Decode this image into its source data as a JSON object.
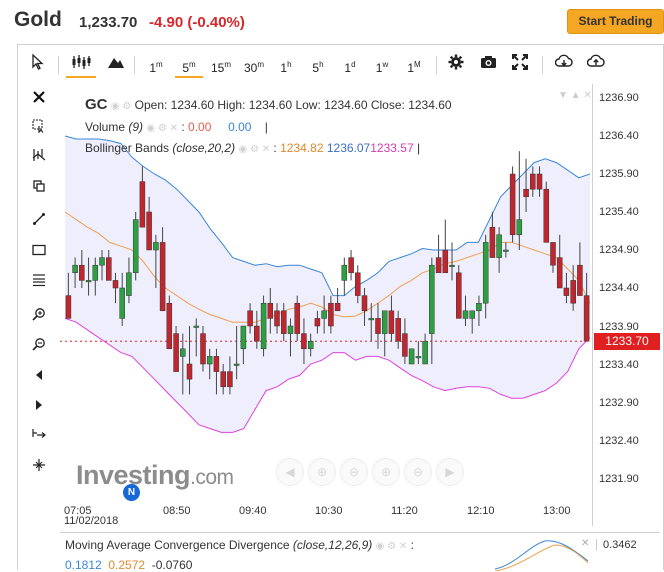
{
  "header": {
    "title": "Gold",
    "price": "1,233.70",
    "change": "-4.90 (-0.40%)",
    "start_trading": "Start Trading"
  },
  "toolbar": {
    "cursor_icon": "cursor-arrow-icon",
    "intervals": [
      {
        "base": "1",
        "sup": "m"
      },
      {
        "base": "5",
        "sup": "m"
      },
      {
        "base": "15",
        "sup": "m"
      },
      {
        "base": "30",
        "sup": "m"
      },
      {
        "base": "1",
        "sup": "h"
      },
      {
        "base": "5",
        "sup": "h"
      },
      {
        "base": "1",
        "sup": "d"
      },
      {
        "base": "1",
        "sup": "w"
      },
      {
        "base": "1",
        "sup": "M"
      }
    ],
    "active_interval": "5m"
  },
  "legend": {
    "symbol": "GC",
    "ohlc": "Open: 1234.60 High: 1234.60 Low: 1234.60 Close: 1234.60",
    "volume_label": "Volume",
    "volume_count": "(9)",
    "volume_val1": "0.00",
    "volume_val2": "0.00",
    "bb_label": "Bollinger Bands",
    "bb_params": "(close,20,2)",
    "bb_val1": "1234.82",
    "bb_val2": "1236.07",
    "bb_val3": "1233.57"
  },
  "price_axis": {
    "labels": [
      "1236.90",
      "1236.40",
      "1235.90",
      "1235.40",
      "1234.90",
      "1234.40",
      "1233.90",
      "1233.40",
      "1232.90",
      "1232.40",
      "1231.90"
    ],
    "current": "1233.70"
  },
  "time_axis": {
    "labels": [
      "07:05",
      "08:50",
      "09:40",
      "10:30",
      "11:20",
      "12:10",
      "13:00"
    ],
    "date": "11/02/2018"
  },
  "watermark": {
    "brand": "Investing",
    "suffix": ".com",
    "badge": "N"
  },
  "macd": {
    "label": "Moving Average Convergence Divergence",
    "params": "(close,12,26,9)",
    "value": "0.3462",
    "v1": "0.1812",
    "v2": "0.2572",
    "v3": "-0.0760"
  },
  "colors": {
    "up": "#2ea043",
    "down": "#c0262d",
    "band_upper": "#3a86d6",
    "band_lower": "#e040e0",
    "band_mid": "#f0a050",
    "band_fill": "#eeeefd",
    "accent": "#f5a623"
  },
  "chart_data": {
    "type": "candlestick",
    "ylim": [
      1231.7,
      1237.05
    ],
    "candles": [
      [
        1234.3,
        1234.6,
        1234.0,
        1234.0
      ],
      [
        1234.6,
        1234.8,
        1234.4,
        1234.7
      ],
      [
        1234.7,
        1234.9,
        1234.4,
        1234.5
      ],
      [
        1234.5,
        1234.8,
        1234.3,
        1234.5
      ],
      [
        1234.5,
        1234.8,
        1234.3,
        1234.7
      ],
      [
        1234.7,
        1234.9,
        1234.5,
        1234.8
      ],
      [
        1234.8,
        1234.9,
        1234.5,
        1234.5
      ],
      [
        1234.5,
        1234.6,
        1234.2,
        1234.4
      ],
      [
        1234.0,
        1234.6,
        1233.9,
        1234.4
      ],
      [
        1234.3,
        1234.8,
        1234.2,
        1234.6
      ],
      [
        1234.6,
        1235.4,
        1234.5,
        1235.3
      ],
      [
        1235.8,
        1236.0,
        1235.2,
        1235.2
      ],
      [
        1235.4,
        1235.6,
        1234.9,
        1234.9
      ],
      [
        1234.9,
        1235.1,
        1234.4,
        1235.0
      ],
      [
        1235.0,
        1235.2,
        1234.1,
        1234.1
      ],
      [
        1234.2,
        1234.3,
        1233.6,
        1233.6
      ],
      [
        1233.8,
        1233.9,
        1233.3,
        1233.3
      ],
      [
        1233.5,
        1233.8,
        1233.0,
        1233.6
      ],
      [
        1233.4,
        1233.9,
        1233.0,
        1233.2
      ],
      [
        1233.9,
        1234.0,
        1233.5,
        1233.9
      ],
      [
        1233.8,
        1233.9,
        1233.3,
        1233.4
      ],
      [
        1233.4,
        1233.6,
        1233.2,
        1233.5
      ],
      [
        1233.5,
        1233.6,
        1233.0,
        1233.3
      ],
      [
        1233.3,
        1233.4,
        1233.0,
        1233.1
      ],
      [
        1233.3,
        1233.5,
        1233.0,
        1233.1
      ],
      [
        1233.4,
        1233.9,
        1233.2,
        1233.4
      ],
      [
        1233.6,
        1233.9,
        1233.4,
        1233.9
      ],
      [
        1234.1,
        1234.2,
        1233.8,
        1233.9
      ],
      [
        1233.9,
        1234.1,
        1233.6,
        1233.7
      ],
      [
        1233.6,
        1234.3,
        1233.5,
        1234.2
      ],
      [
        1234.2,
        1234.4,
        1233.8,
        1234.0
      ],
      [
        1234.1,
        1234.2,
        1233.8,
        1233.9
      ],
      [
        1234.1,
        1234.2,
        1233.7,
        1233.8
      ],
      [
        1233.8,
        1234.0,
        1233.5,
        1233.9
      ],
      [
        1234.2,
        1234.3,
        1233.7,
        1233.8
      ],
      [
        1233.8,
        1234.0,
        1233.4,
        1233.6
      ],
      [
        1233.6,
        1233.8,
        1233.5,
        1233.7
      ],
      [
        1234.0,
        1234.1,
        1233.8,
        1233.9
      ],
      [
        1234.0,
        1234.3,
        1233.8,
        1234.1
      ],
      [
        1234.2,
        1234.3,
        1233.8,
        1233.9
      ],
      [
        1234.2,
        1234.4,
        1234.1,
        1234.1
      ],
      [
        1234.5,
        1234.8,
        1234.3,
        1234.7
      ],
      [
        1234.8,
        1234.9,
        1234.5,
        1234.6
      ],
      [
        1234.6,
        1234.7,
        1234.2,
        1234.3
      ],
      [
        1234.3,
        1234.4,
        1233.9,
        1234.1
      ],
      [
        1234.0,
        1234.2,
        1233.7,
        1234.0
      ],
      [
        1234.0,
        1234.2,
        1233.6,
        1233.8
      ],
      [
        1233.8,
        1234.0,
        1233.5,
        1234.1
      ],
      [
        1234.1,
        1234.3,
        1233.7,
        1233.8
      ],
      [
        1234.0,
        1234.1,
        1233.6,
        1233.7
      ],
      [
        1233.8,
        1234.0,
        1233.4,
        1233.5
      ],
      [
        1233.4,
        1233.6,
        1233.4,
        1233.6
      ],
      [
        1233.5,
        1233.7,
        1233.4,
        1233.5
      ],
      [
        1233.4,
        1233.8,
        1233.4,
        1233.7
      ],
      [
        1233.8,
        1234.8,
        1233.4,
        1234.7
      ],
      [
        1234.8,
        1235.1,
        1234.6,
        1234.6
      ],
      [
        1234.9,
        1235.3,
        1234.7,
        1234.6
      ],
      [
        1234.7,
        1235.0,
        1234.5,
        1234.7
      ],
      [
        1234.6,
        1234.7,
        1234.0,
        1234.0
      ],
      [
        1234.0,
        1234.3,
        1233.9,
        1234.1
      ],
      [
        1234.0,
        1234.1,
        1233.8,
        1234.1
      ],
      [
        1234.1,
        1234.3,
        1233.9,
        1234.2
      ],
      [
        1234.2,
        1235.1,
        1234.0,
        1235.0
      ],
      [
        1235.2,
        1235.4,
        1234.8,
        1234.8
      ],
      [
        1234.8,
        1235.2,
        1234.6,
        1235.1
      ],
      [
        1234.9,
        1235.0,
        1234.8,
        1234.9
      ],
      [
        1235.9,
        1236.0,
        1235.0,
        1235.1
      ],
      [
        1235.1,
        1236.2,
        1234.9,
        1235.3
      ],
      [
        1235.7,
        1236.1,
        1235.4,
        1235.6
      ],
      [
        1235.9,
        1236.0,
        1235.6,
        1235.7
      ],
      [
        1235.9,
        1236.0,
        1235.6,
        1235.7
      ],
      [
        1235.7,
        1235.8,
        1235.0,
        1235.0
      ],
      [
        1235.0,
        1235.0,
        1234.6,
        1234.7
      ],
      [
        1234.8,
        1235.1,
        1234.4,
        1234.4
      ],
      [
        1234.4,
        1234.6,
        1234.2,
        1234.3
      ],
      [
        1234.5,
        1234.7,
        1234.1,
        1234.2
      ],
      [
        1234.7,
        1235.0,
        1234.3,
        1234.3
      ],
      [
        1234.3,
        1234.6,
        1233.7,
        1233.7
      ]
    ],
    "bollinger": {
      "upper": [
        1236.4,
        1236.36,
        1236.36,
        1236.36,
        1236.34,
        1236.3,
        1236.12,
        1236.0,
        1235.9,
        1235.82,
        1235.7,
        1235.55,
        1235.4,
        1235.18,
        1235.0,
        1234.8,
        1234.75,
        1234.7,
        1234.72,
        1234.68,
        1234.7,
        1234.7,
        1234.65,
        1234.6,
        1234.3,
        1234.3,
        1234.42,
        1234.5,
        1234.6,
        1234.75,
        1234.8,
        1234.85,
        1234.92,
        1234.9,
        1234.9,
        1234.9,
        1235.0,
        1235.0,
        1235.3,
        1235.6,
        1235.75,
        1235.9,
        1236.05,
        1236.1,
        1236.05,
        1235.95,
        1235.85,
        1235.9
      ],
      "middle": [
        1235.4,
        1235.3,
        1235.2,
        1235.12,
        1235.0,
        1234.95,
        1234.9,
        1234.75,
        1234.55,
        1234.4,
        1234.3,
        1234.2,
        1234.12,
        1234.05,
        1234.0,
        1233.95,
        1233.95,
        1233.95,
        1234.0,
        1234.05,
        1234.12,
        1234.15,
        1234.2,
        1234.15,
        1234.05,
        1234.02,
        1234.03,
        1234.1,
        1234.2,
        1234.3,
        1234.42,
        1234.5,
        1234.6,
        1234.65,
        1234.72,
        1234.75,
        1234.8,
        1234.85,
        1234.9,
        1235.0,
        1235.0,
        1234.95,
        1234.9,
        1234.85,
        1234.8,
        1234.65,
        1234.5,
        1234.2
      ],
      "lower": [
        1234.0,
        1233.95,
        1233.85,
        1233.75,
        1233.65,
        1233.55,
        1233.5,
        1233.35,
        1233.2,
        1233.05,
        1232.9,
        1232.75,
        1232.6,
        1232.55,
        1232.5,
        1232.5,
        1232.55,
        1232.8,
        1233.05,
        1233.1,
        1233.2,
        1233.25,
        1233.4,
        1233.45,
        1233.55,
        1233.55,
        1233.45,
        1233.5,
        1233.5,
        1233.45,
        1233.35,
        1233.25,
        1233.18,
        1233.1,
        1233.05,
        1233.08,
        1233.1,
        1233.1,
        1233.08,
        1233.0,
        1232.95,
        1232.95,
        1233.0,
        1233.05,
        1233.15,
        1233.3,
        1233.6,
        1233.75
      ]
    }
  }
}
